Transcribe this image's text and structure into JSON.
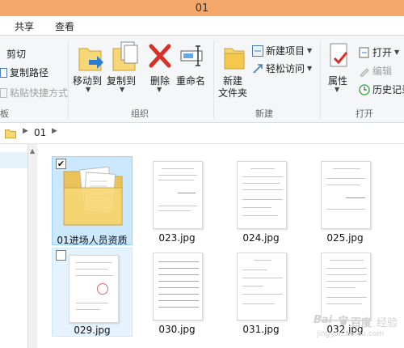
{
  "window": {
    "title": "01"
  },
  "tabs": [
    {
      "label": "共享"
    },
    {
      "label": "查看"
    }
  ],
  "ribbon": {
    "clipboard": {
      "cut": "剪切",
      "copy_path": "复制路径",
      "paste_shortcut": "粘贴快捷方式",
      "group_label": "板"
    },
    "organize": {
      "move_to": "移动到",
      "copy_to": "复制到",
      "delete": "删除",
      "rename": "重命名",
      "group_label": "组织"
    },
    "new": {
      "new_folder": "新建\n文件夹",
      "new_folder_l1": "新建",
      "new_folder_l2": "文件夹",
      "new_item": "新建项目",
      "easy_access": "轻松访问",
      "group_label": "新建"
    },
    "open": {
      "properties": "属性",
      "open": "打开",
      "edit": "编辑",
      "history": "历史记录",
      "group_label": "打开"
    }
  },
  "address": {
    "path": [
      "01"
    ]
  },
  "files": [
    {
      "name": "01进场人员资质",
      "type": "folder",
      "selected": true,
      "checked": true
    },
    {
      "name": "023.jpg",
      "type": "image"
    },
    {
      "name": "024.jpg",
      "type": "image"
    },
    {
      "name": "025.jpg",
      "type": "image"
    },
    {
      "name": "029.jpg",
      "type": "image",
      "hover": true,
      "checked": false
    },
    {
      "name": "030.jpg",
      "type": "image"
    },
    {
      "name": "031.jpg",
      "type": "image"
    },
    {
      "name": "032.jpg",
      "type": "image"
    }
  ],
  "watermark": {
    "text": "Bai百度 经验",
    "brand": "Bai",
    "brand_cn": "百度",
    "sub": "经验",
    "url": "jingyan.baidu.com"
  },
  "colors": {
    "titlebar": "#f5a86a",
    "selection": "#cce8ff",
    "folder": "#f7d775",
    "delete_red": "#d93025",
    "move_blue": "#2b7cd3"
  }
}
